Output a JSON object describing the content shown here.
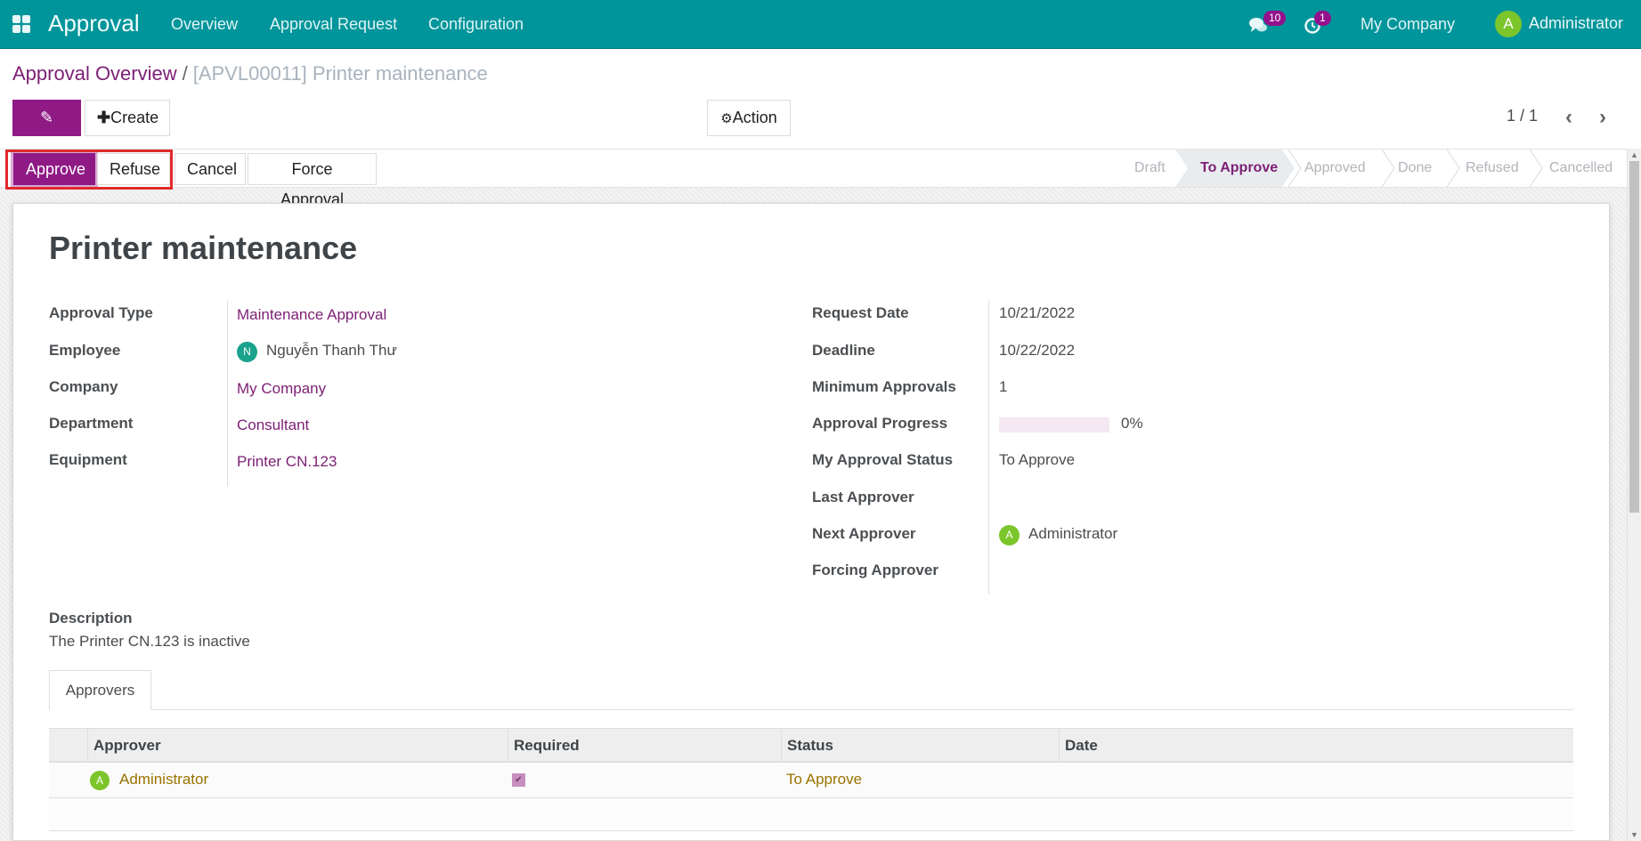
{
  "navbar": {
    "app_title": "Approval",
    "menu": [
      "Overview",
      "Approval Request",
      "Configuration"
    ],
    "messages_badge": "10",
    "activities_badge": "1",
    "company": "My Company",
    "user_initial": "A",
    "user_name": "Administrator"
  },
  "breadcrumb": {
    "parent": "Approval Overview",
    "separator": "/",
    "current": "[APVL00011] Printer maintenance"
  },
  "control_panel": {
    "edit_label": "Edit",
    "create_label": "Create",
    "action_label": "Action",
    "pager": "1 / 1"
  },
  "statusbar": {
    "buttons": [
      "Approve",
      "Refuse",
      "Cancel",
      "Force Approval"
    ],
    "stages": [
      "Draft",
      "To Approve",
      "Approved",
      "Done",
      "Refused",
      "Cancelled"
    ],
    "active_stage": "To Approve"
  },
  "form": {
    "title": "Printer maintenance",
    "left_fields": [
      {
        "label": "Approval Type",
        "value": "Maintenance Approval"
      },
      {
        "label": "Employee",
        "value": "Nguyễn Thanh Thư",
        "avatar": "N"
      },
      {
        "label": "Company",
        "value": "My Company"
      },
      {
        "label": "Department",
        "value": "Consultant"
      },
      {
        "label": "Equipment",
        "value": "Printer CN.123"
      }
    ],
    "right_fields": [
      {
        "label": "Request Date",
        "value": "10/21/2022"
      },
      {
        "label": "Deadline",
        "value": "10/22/2022"
      },
      {
        "label": "Minimum Approvals",
        "value": "1"
      },
      {
        "label": "Approval Progress",
        "value": "0%",
        "progress_percent": 0
      },
      {
        "label": "My Approval Status",
        "value": "To Approve"
      },
      {
        "label": "Last Approver",
        "value": ""
      },
      {
        "label": "Next Approver",
        "value": "Administrator",
        "avatar": "A"
      },
      {
        "label": "Forcing Approver",
        "value": ""
      }
    ],
    "description_label": "Description",
    "description": "The Printer CN.123 is inactive"
  },
  "tabs": [
    "Approvers"
  ],
  "approvers_table": {
    "columns": [
      "Approver",
      "Required",
      "Status",
      "Date"
    ],
    "rows": [
      {
        "approver": "Administrator",
        "avatar": "A",
        "required": true,
        "status": "To Approve",
        "date": ""
      }
    ]
  },
  "colors": {
    "navbar": "#00959b",
    "primary": "#8f1a85",
    "link": "#7c1f74",
    "highlight": "#e02b2b",
    "avatar_green": "#7cc52a",
    "avatar_teal": "#1aa38c",
    "row_text": "#9a7300"
  }
}
